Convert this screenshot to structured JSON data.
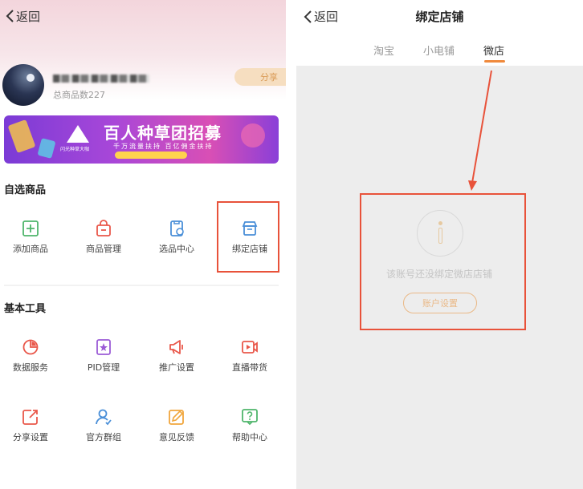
{
  "left_screen": {
    "back_label": "返回",
    "goods_count": "总商品数227",
    "share_label": "分享",
    "banner": {
      "title": "百人种草团招募",
      "subtitle": "千万流量扶持 百亿佣金扶持",
      "logo_text": "闪光种草大咖"
    },
    "self_select_section": {
      "title": "自选商品",
      "items": [
        {
          "label": "添加商品",
          "icon": "add-goods-icon"
        },
        {
          "label": "商品管理",
          "icon": "goods-manage-icon"
        },
        {
          "label": "选品中心",
          "icon": "selection-center-icon"
        },
        {
          "label": "绑定店铺",
          "icon": "bind-shop-icon"
        }
      ]
    },
    "tools_section": {
      "title": "基本工具",
      "items": [
        {
          "label": "数据服务",
          "icon": "data-service-icon"
        },
        {
          "label": "PID管理",
          "icon": "pid-manage-icon"
        },
        {
          "label": "推广设置",
          "icon": "promotion-icon"
        },
        {
          "label": "直播带货",
          "icon": "live-stream-icon"
        },
        {
          "label": "分享设置",
          "icon": "share-settings-icon"
        },
        {
          "label": "官方群组",
          "icon": "official-group-icon"
        },
        {
          "label": "意见反馈",
          "icon": "feedback-icon"
        },
        {
          "label": "帮助中心",
          "icon": "help-center-icon"
        }
      ]
    }
  },
  "right_screen": {
    "back_label": "返回",
    "title": "绑定店铺",
    "tabs": [
      {
        "label": "淘宝",
        "active": false
      },
      {
        "label": "小电铺",
        "active": false
      },
      {
        "label": "微店",
        "active": true
      }
    ],
    "empty_message": "该账号还没绑定微店店铺",
    "account_button": "账户设置"
  },
  "colors": {
    "highlight": "#e8523a",
    "accent_orange": "#f08a3c",
    "icon_green": "#4fb56b",
    "icon_red": "#e9574a",
    "icon_blue": "#4a8fd8",
    "icon_purple": "#9b5bd6",
    "icon_orange": "#f0a63c"
  }
}
